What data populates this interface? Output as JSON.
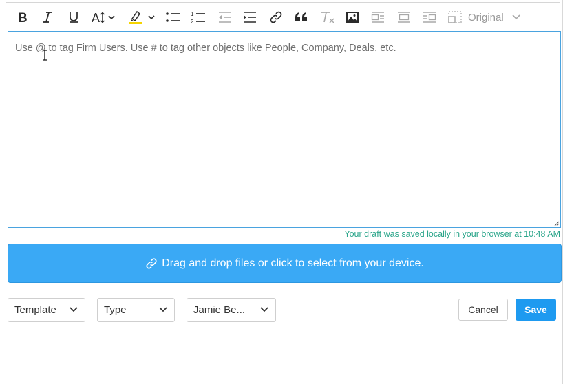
{
  "toolbar": {
    "image_size_label": "Original"
  },
  "editor": {
    "placeholder": "Use @ to tag Firm Users. Use # to tag other objects like People, Company, Deals, etc."
  },
  "draft_status": "Your draft was saved locally in your browser at 10:48 AM",
  "dropzone": {
    "label": "Drag and drop files or click to select from your device."
  },
  "footer": {
    "template_select": "Template",
    "type_select": "Type",
    "owner_select": "Jamie Be...",
    "cancel_label": "Cancel",
    "save_label": "Save"
  },
  "colors": {
    "accent": "#3aa9f5",
    "save_button": "#1e9af0",
    "draft_text": "#2aa58a",
    "editor_border": "#4aa3df",
    "highlight": "#f5d400"
  },
  "icons": [
    "bold-icon",
    "italic-icon",
    "underline-icon",
    "font-size-icon",
    "highlight-icon",
    "bulleted-list-icon",
    "numbered-list-icon",
    "outdent-icon",
    "indent-icon",
    "link-icon",
    "blockquote-icon",
    "clear-format-icon",
    "image-icon",
    "image-wrap-left-icon",
    "image-center-icon",
    "image-wrap-right-icon",
    "image-size-icon",
    "chevron-down-icon",
    "paperclip-icon"
  ]
}
